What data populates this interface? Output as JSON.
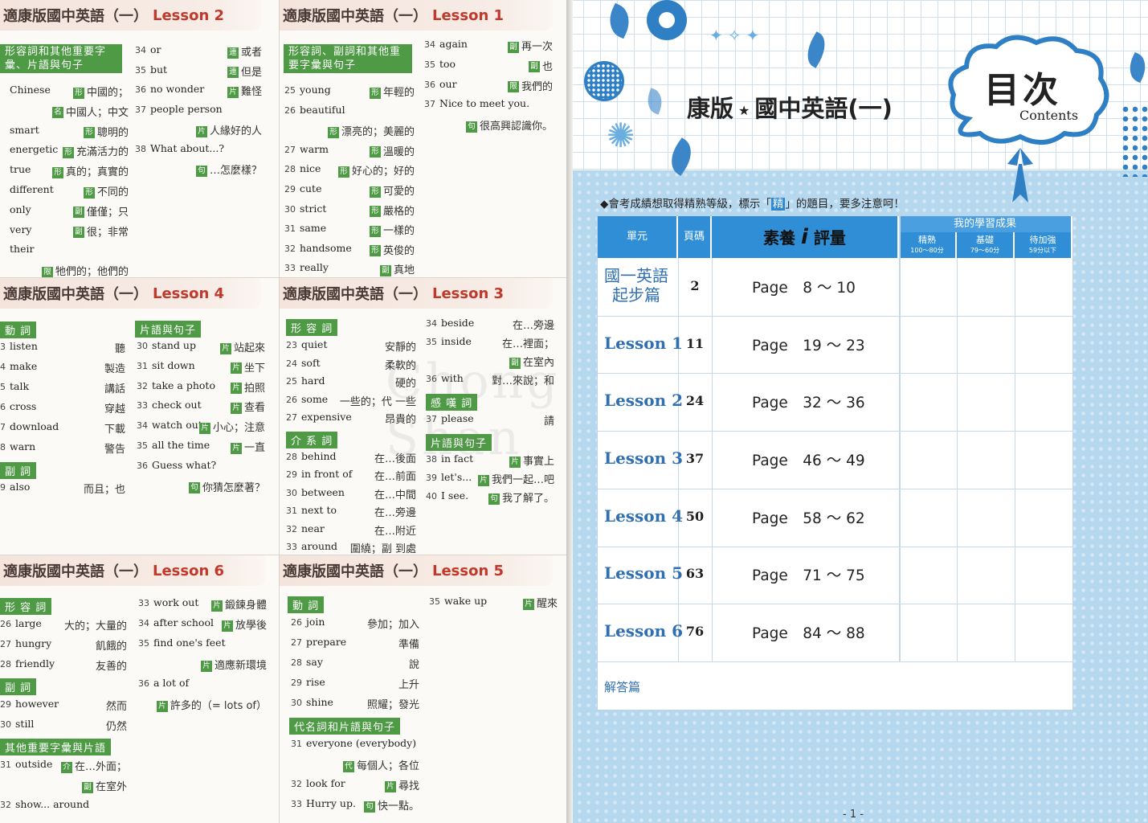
{
  "left_cards": {
    "l2": {
      "title": "適康版國中英語（一）",
      "lesson": "Lesson 2",
      "cat": "形容詞和其他重要字彙、片語與句子",
      "c1": [
        [
          "",
          "Chinese",
          "形",
          "中國的；"
        ],
        [
          "",
          "",
          "名",
          "中國人；中文"
        ],
        [
          "",
          "smart",
          "形",
          "聰明的"
        ],
        [
          "",
          "energetic",
          "形",
          "充滿活力的"
        ],
        [
          "",
          "true",
          "形",
          "真的；真實的"
        ],
        [
          "",
          "different",
          "形",
          "不同的"
        ],
        [
          "",
          "only",
          "副",
          "僅僅；只"
        ],
        [
          "",
          "very",
          "副",
          "很；非常"
        ],
        [
          "",
          "their",
          "",
          ""
        ],
        [
          "",
          "",
          "限",
          "牠們的；他們的"
        ]
      ],
      "c2": [
        [
          "34",
          "or",
          "連",
          "或者"
        ],
        [
          "35",
          "but",
          "連",
          "但是"
        ],
        [
          "36",
          "no wonder",
          "片",
          "難怪"
        ],
        [
          "37",
          "people person",
          "",
          ""
        ],
        [
          "",
          "",
          "片",
          "人緣好的人"
        ],
        [
          "38",
          "What about...?",
          "",
          ""
        ],
        [
          "",
          "",
          "句",
          "…怎麼樣？"
        ]
      ]
    },
    "l1": {
      "title": "適康版國中英語（一）",
      "lesson": "Lesson 1",
      "cat": "形容詞、副詞和其他重要字彙與句子",
      "c1": [
        [
          "25",
          "young",
          "形",
          "年輕的"
        ],
        [
          "26",
          "beautiful",
          "",
          ""
        ],
        [
          "",
          "",
          "形",
          "漂亮的；美麗的"
        ],
        [
          "27",
          "warm",
          "形",
          "溫暖的"
        ],
        [
          "28",
          "nice",
          "形",
          "好心的；好的"
        ],
        [
          "29",
          "cute",
          "形",
          "可愛的"
        ],
        [
          "30",
          "strict",
          "形",
          "嚴格的"
        ],
        [
          "31",
          "same",
          "形",
          "一樣的"
        ],
        [
          "32",
          "handsome",
          "形",
          "英俊的"
        ],
        [
          "33",
          "really",
          "副",
          "真地"
        ]
      ],
      "c2": [
        [
          "34",
          "again",
          "副",
          "再一次"
        ],
        [
          "35",
          "too",
          "副",
          "也"
        ],
        [
          "36",
          "our",
          "限",
          "我們的"
        ],
        [
          "37",
          "Nice to meet you.",
          "",
          ""
        ],
        [
          "",
          "",
          "句",
          "很高興認識你。"
        ]
      ]
    },
    "l4": {
      "title": "適康版國中英語（一）",
      "lesson": "Lesson 4",
      "cat1": "動 詞",
      "cat2": "副 詞",
      "cat3": "片語與句子",
      "c1": [
        [
          "3",
          "listen",
          "",
          "聽"
        ],
        [
          "4",
          "make",
          "",
          "製造"
        ],
        [
          "5",
          "talk",
          "",
          "講話"
        ],
        [
          "6",
          "cross",
          "",
          "穿越"
        ],
        [
          "7",
          "download",
          "",
          "下載"
        ],
        [
          "8",
          "warn",
          "",
          "警告"
        ]
      ],
      "c1b": [
        [
          "9",
          "also",
          "",
          "而且；也"
        ]
      ],
      "c2": [
        [
          "30",
          "stand up",
          "片",
          "站起來"
        ],
        [
          "31",
          "sit down",
          "片",
          "坐下"
        ],
        [
          "32",
          "take a photo",
          "片",
          "拍照"
        ],
        [
          "33",
          "check out",
          "片",
          "查看"
        ],
        [
          "34",
          "watch out",
          "片",
          "小心；注意"
        ],
        [
          "35",
          "all the time",
          "片",
          "一直"
        ],
        [
          "36",
          "Guess what?",
          "",
          ""
        ],
        [
          "",
          "",
          "句",
          "你猜怎麼著？"
        ]
      ]
    },
    "l3": {
      "title": "適康版國中英語（一）",
      "lesson": "Lesson 3",
      "cat1": "形 容 詞",
      "cat2": "介 系 詞",
      "cat3": "感 嘆 詞",
      "cat4": "片語與句子",
      "c1": [
        [
          "23",
          "quiet",
          "",
          "安靜的"
        ],
        [
          "24",
          "soft",
          "",
          "柔軟的"
        ],
        [
          "25",
          "hard",
          "",
          "硬的"
        ],
        [
          "26",
          "some",
          "",
          "一些的；代 一些"
        ],
        [
          "27",
          "expensive",
          "",
          "昂貴的"
        ]
      ],
      "c1b": [
        [
          "28",
          "behind",
          "",
          "在…後面"
        ],
        [
          "29",
          "in front of",
          "",
          "在…前面"
        ],
        [
          "30",
          "between",
          "",
          "在…中間"
        ],
        [
          "31",
          "next to",
          "",
          "在…旁邊"
        ],
        [
          "32",
          "near",
          "",
          "在…附近"
        ],
        [
          "33",
          "around",
          "",
          "圍繞；副 到處"
        ]
      ],
      "c2": [
        [
          "34",
          "beside",
          "",
          "在…旁邊"
        ],
        [
          "35",
          "inside",
          "",
          "在…裡面；"
        ],
        [
          "",
          "",
          "副",
          "在室內"
        ],
        [
          "36",
          "with",
          "",
          "對…來說；和"
        ]
      ],
      "c2b": [
        [
          "37",
          "please",
          "",
          "請"
        ]
      ],
      "c2c": [
        [
          "38",
          "in fact",
          "片",
          "事實上"
        ],
        [
          "39",
          "let's...",
          "片",
          "我們一起…吧"
        ],
        [
          "40",
          "I see.",
          "句",
          "我了解了。"
        ]
      ]
    },
    "l6": {
      "title": "適康版國中英語（一）",
      "lesson": "Lesson 6",
      "cat1": "形 容 詞",
      "cat2": "副 詞",
      "cat3": "其他重要字彙與片語",
      "c1": [
        [
          "26",
          "large",
          "",
          "大的；大量的"
        ],
        [
          "27",
          "hungry",
          "",
          "飢餓的"
        ],
        [
          "28",
          "friendly",
          "",
          "友善的"
        ]
      ],
      "c1b": [
        [
          "29",
          "however",
          "",
          "然而"
        ],
        [
          "30",
          "still",
          "",
          "仍然"
        ]
      ],
      "c1c": [
        [
          "31",
          "outside",
          "介",
          "在…外面；"
        ],
        [
          "",
          "",
          "副",
          "在室外"
        ],
        [
          "32",
          "show... around",
          "",
          ""
        ]
      ],
      "c2": [
        [
          "33",
          "work out",
          "片",
          "鍛鍊身體"
        ],
        [
          "34",
          "after school",
          "片",
          "放學後"
        ],
        [
          "35",
          "find one's feet",
          "",
          ""
        ],
        [
          "",
          "",
          "片",
          "適應新環境"
        ],
        [
          "36",
          "a lot of",
          "",
          ""
        ],
        [
          "",
          "",
          "片",
          "許多的（= lots of）"
        ]
      ]
    },
    "l5": {
      "title": "適康版國中英語（一）",
      "lesson": "Lesson 5",
      "cat1": "動 詞",
      "cat2": "代名詞和片語與句子",
      "c1": [
        [
          "26",
          "join",
          "",
          "參加；加入"
        ],
        [
          "27",
          "prepare",
          "",
          "準備"
        ],
        [
          "28",
          "say",
          "",
          "說"
        ],
        [
          "29",
          "rise",
          "",
          "上升"
        ],
        [
          "30",
          "shine",
          "",
          "照耀；發光"
        ]
      ],
      "c1b": [
        [
          "31",
          "everyone (everybody)",
          "",
          ""
        ],
        [
          "",
          "",
          "代",
          "每個人；各位"
        ],
        [
          "32",
          "look for",
          "片",
          "尋找"
        ],
        [
          "33",
          "Hurry up.",
          "句",
          "快一點。"
        ]
      ],
      "c2": [
        [
          "35",
          "wake up",
          "片",
          "醒來"
        ]
      ]
    }
  },
  "right": {
    "title_left": "康版",
    "title_star": "★",
    "title_right": "國中英語(一)",
    "cloud_title": "目次",
    "cloud_sub": "Contents",
    "note_pre": "◆會考成績想取得精熟等級，標示「",
    "note_mark": "精",
    "note_post": "」的題目，要多注意呵！",
    "headers": {
      "unit": "單元",
      "page": "頁碼",
      "assess": "素養",
      "assess2": "評量",
      "result": "我的學習成果",
      "r1": "精熟",
      "r1s": "100～80分",
      "r2": "基礎",
      "r2s": "79～60分",
      "r3": "待加強",
      "r3s": "59分以下"
    },
    "rows": [
      {
        "unit_a": "國一英語",
        "unit_b": "起步篇",
        "page": "2",
        "range": "Page　8 ～ 10"
      },
      {
        "unit_a": "Lesson 1",
        "unit_b": "",
        "page": "11",
        "range": "Page　19 ～ 23"
      },
      {
        "unit_a": "Lesson 2",
        "unit_b": "",
        "page": "24",
        "range": "Page　32 ～ 36"
      },
      {
        "unit_a": "Lesson 3",
        "unit_b": "",
        "page": "37",
        "range": "Page　46 ～ 49"
      },
      {
        "unit_a": "Lesson 4",
        "unit_b": "",
        "page": "50",
        "range": "Page　58 ～ 62"
      },
      {
        "unit_a": "Lesson 5",
        "unit_b": "",
        "page": "63",
        "range": "Page　71 ～ 75"
      },
      {
        "unit_a": "Lesson 6",
        "unit_b": "",
        "page": "76",
        "range": "Page　84 ～ 88"
      }
    ],
    "answers": "解答篇",
    "page_num": "- 1 -"
  },
  "colors": {
    "green": "#4e9a45",
    "blue": "#2f8ed6",
    "red": "#c0392b"
  }
}
